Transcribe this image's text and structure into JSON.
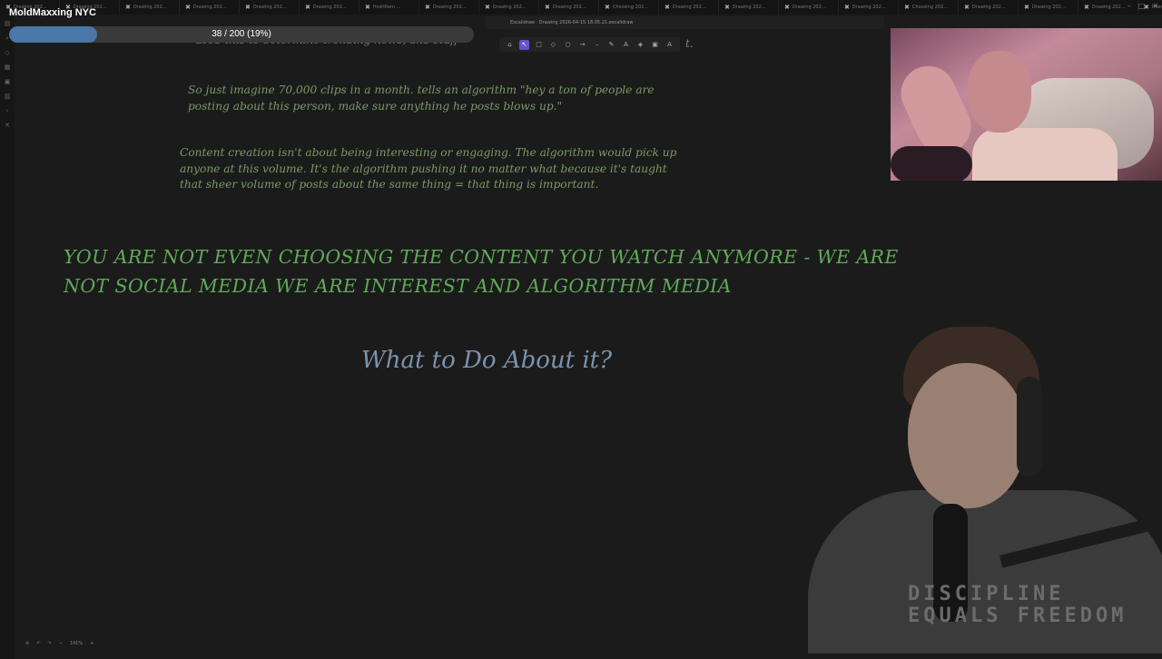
{
  "browser": {
    "tabs": [
      "Drawing 202...",
      "Drawing 202...",
      "Drawing 202...",
      "Drawing 202...",
      "Drawing 202...",
      "Drawing 202...",
      "Hostiflarn ...",
      "Drawing 202...",
      "Drawing 202...",
      "Drawing 202...",
      "Choosing 202...",
      "Drawing 202...",
      "Drawing 202...",
      "Drawing 202...",
      "Drawing 202...",
      "Choosing 202...",
      "Drawing 202...",
      "Drawing 202...",
      "Drawing 202...",
      "Interest Vete...",
      "Drawing ..."
    ],
    "active_tab_index": 20
  },
  "overlay": {
    "channel_name": "MoldMaxxing NYC",
    "progress_text": "38 / 200 (19%)",
    "progress_fraction": 0.19
  },
  "document": {
    "title": "Excalidraw · Drawing 2026-04-15 18.05.21.excalidraw"
  },
  "toolbar_tools": [
    "lock-icon",
    "select-icon",
    "rectangle-icon",
    "diamond-icon",
    "ellipse-icon",
    "arrow-icon",
    "line-icon",
    "pencil-icon",
    "text-icon",
    "eraser-icon",
    "image-icon",
    "library-icon"
  ],
  "canvas": {
    "top_clipped_text": "used this to determine trending news, and stuff",
    "top_tail": "t.",
    "para1": "So just imagine 70,000 clips in a month. tells an algorithm \"hey a ton of people are posting about this person, make sure anything he posts blows up.\"",
    "para2": "Content creation isn't about being interesting or engaging. The algorithm would pick up anyone at this volume. It's the algorithm pushing it no matter what because it's taught that sheer volume of posts about the same thing = that thing is important.",
    "headline": "YOU ARE NOT EVEN CHOOSING THE CONTENT YOU WATCH ANYMORE - WE ARE NOT SOCIAL MEDIA WE ARE INTEREST AND ALGORITHM MEDIA",
    "question": "What to Do About it?"
  },
  "bottom_bar": {
    "zoom": "141%"
  },
  "webcam": {
    "shirt_text": "DISCIPLINE EQUALS FREEDOM"
  },
  "colors": {
    "canvas_bg": "#1b1b1b",
    "body_text": "#7b9a66",
    "headline": "#5faa58",
    "question": "#7b93ad",
    "progress_fill": "#4a78a8"
  }
}
